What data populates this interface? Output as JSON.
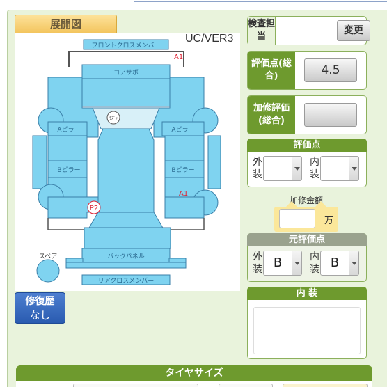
{
  "diagram": {
    "tab_label": "展開図",
    "version_label": "UC/VER3",
    "parts": {
      "front_cross_member": "フロントクロスメンバー",
      "core_support": "コアサポ",
      "a_pillar_left": "Aピラー",
      "a_pillar_right": "Aピラー",
      "b_pillar_left": "Bピラー",
      "b_pillar_right": "Bピラー",
      "back_panel": "バックパネル",
      "rear_cross_member": "リアクロスメンバー",
      "spare": "スペア",
      "rasu": "ﾗｽﾞﾝ"
    },
    "marks": {
      "a1_top": "A1",
      "a1_right": "A1",
      "p2": "P2"
    }
  },
  "repair_history": {
    "title": "修復歴",
    "value": "なし"
  },
  "inspector": {
    "label": "検査担当",
    "change_button": "変更"
  },
  "overall_score": {
    "label": "評価点(総合)",
    "value": "4.5"
  },
  "repair_eval": {
    "label": "加修評価(総合)",
    "value": ""
  },
  "score": {
    "header": "評価点",
    "exterior_label": "外装",
    "interior_label": "内装",
    "exterior_value": "",
    "interior_value": ""
  },
  "repair_amount": {
    "label": "加修金額",
    "unit": "万",
    "value": ""
  },
  "original_score": {
    "header": "元評価点",
    "exterior_label": "外装",
    "interior_label": "内装",
    "exterior_value": "B",
    "interior_value": "B"
  },
  "interior": {
    "header": "内 装",
    "text": ""
  },
  "tire": {
    "header": "タイヤサイズ"
  },
  "colors": {
    "panel_green": "#6e9a2e",
    "part_blue": "#7fd3f0",
    "background": "#e9f3dc"
  }
}
